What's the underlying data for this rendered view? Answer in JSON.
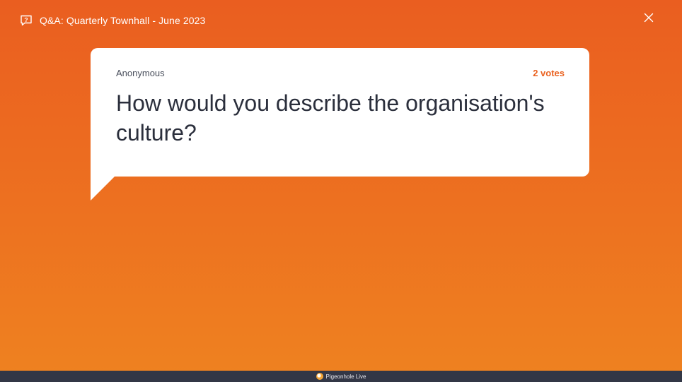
{
  "header": {
    "icon": "chat-question-icon",
    "title": "Q&A: Quarterly Townhall - June 2023"
  },
  "controls": {
    "close_icon": "close-icon"
  },
  "question_card": {
    "author": "Anonymous",
    "votes": "2 votes",
    "text": "How would you describe the organisation's culture?"
  },
  "footer": {
    "logo_icon": "pigeonhole-logo-icon",
    "brand": "Pigeonhole Live"
  },
  "colors": {
    "background_top": "#ea5e20",
    "background_bottom": "#ee8220",
    "accent": "#ea6220",
    "card": "#ffffff",
    "footer_bar": "#333746"
  }
}
